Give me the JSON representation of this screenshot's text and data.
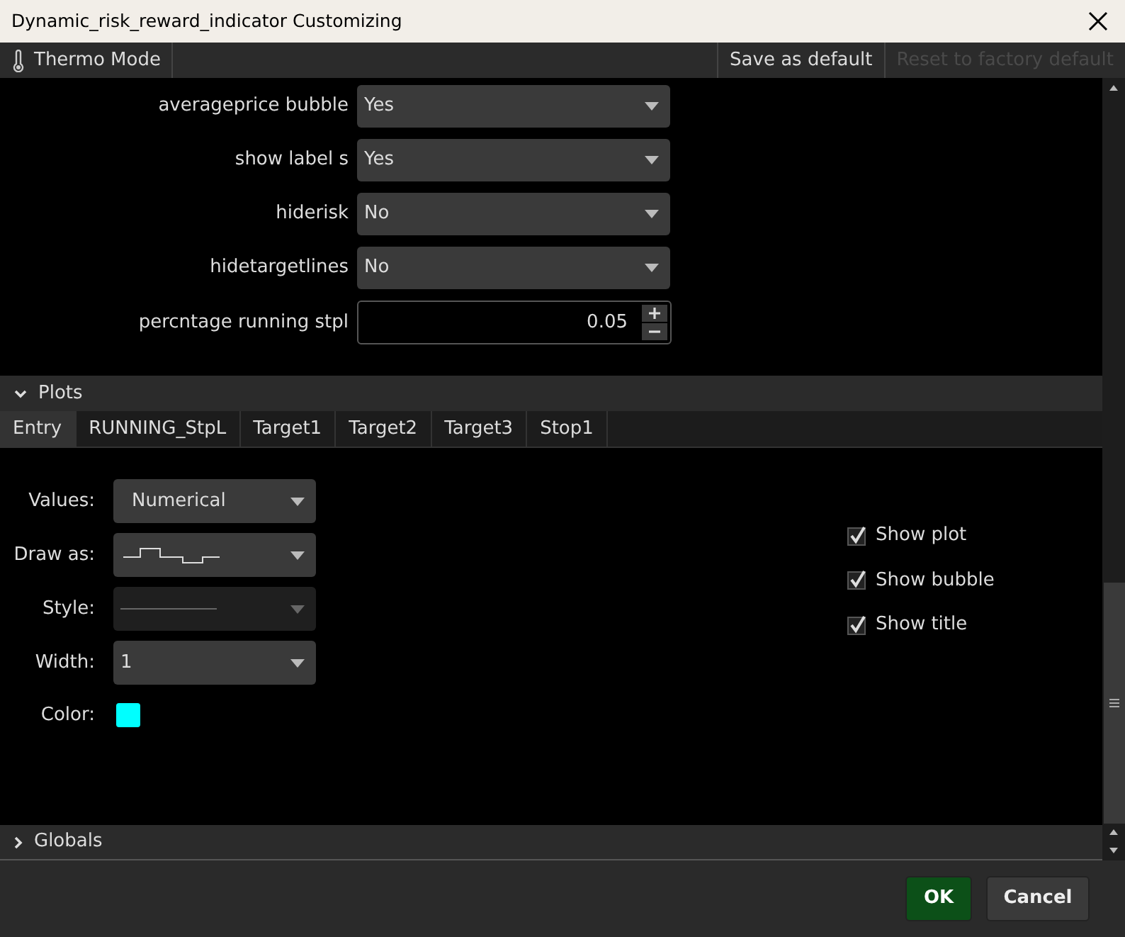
{
  "window": {
    "title": "Dynamic_risk_reward_indicator Customizing"
  },
  "toolbar": {
    "thermo_mode": "Thermo Mode",
    "save_default": {
      "label": "Save as default",
      "disabled": false
    },
    "reset_default": {
      "label": "Reset to factory default",
      "disabled": true
    }
  },
  "inputs": [
    {
      "label": "averageprice bubble",
      "kind": "select",
      "value": "Yes"
    },
    {
      "label": "show label s",
      "kind": "select",
      "value": "Yes"
    },
    {
      "label": "hiderisk",
      "kind": "select",
      "value": "No"
    },
    {
      "label": "hidetargetlines",
      "kind": "select",
      "value": "No"
    },
    {
      "label": "percntage running stpl",
      "kind": "number",
      "value": "0.05"
    }
  ],
  "plots": {
    "title": "Plots",
    "expanded": true,
    "tabs": [
      {
        "label": "Entry",
        "selected": true
      },
      {
        "label": "RUNNING_StpL",
        "selected": false
      },
      {
        "label": "Target1",
        "selected": false
      },
      {
        "label": "Target2",
        "selected": false
      },
      {
        "label": "Target3",
        "selected": false
      },
      {
        "label": "Stop1",
        "selected": false
      }
    ],
    "settings": [
      {
        "label": "Values:",
        "kind": "select",
        "value": "Numerical",
        "disabled": false
      },
      {
        "label": "Draw as:",
        "kind": "drawas",
        "disabled": false
      },
      {
        "label": "Style:",
        "kind": "style",
        "disabled": true
      },
      {
        "label": "Width:",
        "kind": "select",
        "value": "1",
        "disabled": false
      },
      {
        "label": "Color:",
        "kind": "color",
        "color": "#00ffff"
      }
    ],
    "checks": [
      {
        "label": "Show plot",
        "checked": true
      },
      {
        "label": "Show bubble",
        "checked": true
      },
      {
        "label": "Show title",
        "checked": true
      }
    ]
  },
  "globals": {
    "title": "Globals",
    "expanded": false
  },
  "buttons": [
    {
      "label": "OK",
      "kind": "primary"
    },
    {
      "label": "Cancel",
      "kind": "secondary"
    }
  ]
}
